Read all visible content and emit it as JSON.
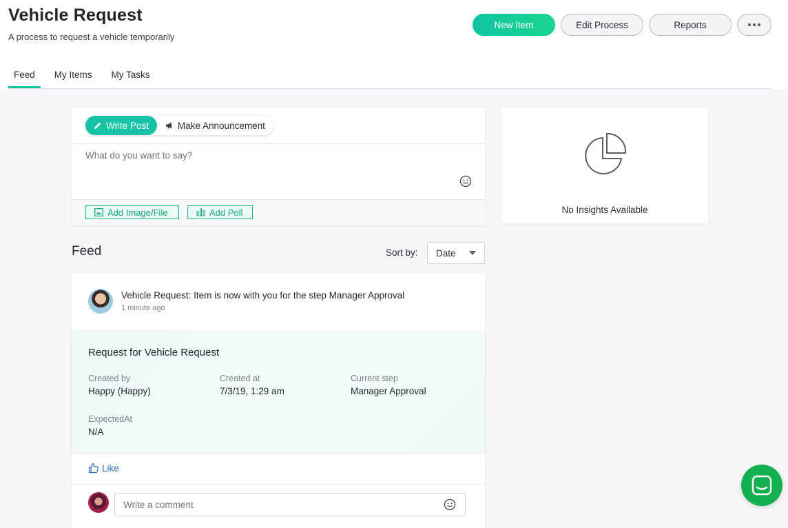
{
  "header": {
    "title": "Vehicle Request",
    "subtitle": "A process to request a vehicle temporarily",
    "buttons": {
      "new_item": "New Item",
      "edit_process": "Edit Process",
      "reports": "Reports"
    },
    "tabs": [
      "Feed",
      "My Items",
      "My Tasks"
    ],
    "active_tab": "Feed"
  },
  "composer": {
    "tabs": {
      "write_post": "Write Post",
      "make_announcement": "Make Announcement"
    },
    "placeholder": "What do you want to say?",
    "add_image": "Add Image/File",
    "add_poll": "Add Poll"
  },
  "insights": {
    "empty_text": "No Insights Available"
  },
  "feed": {
    "title": "Feed",
    "sort_label": "Sort by:",
    "sort_value": "Date",
    "item": {
      "message": "Vehicle Request: Item is now with you for the step Manager Approval",
      "time": "1 minute ago",
      "request_title": "Request for Vehicle Request",
      "fields": {
        "created_by": {
          "label": "Created by",
          "value": "Happy (Happy)"
        },
        "created_at": {
          "label": "Created at",
          "value": "7/3/19, 1:29 am"
        },
        "current_step": {
          "label": "Current step",
          "value": "Manager Approval"
        },
        "expected_at": {
          "label": "ExpectedAt",
          "value": "N/A"
        }
      },
      "like_label": "Like",
      "comment_placeholder": "Write a comment"
    }
  },
  "colors": {
    "accent": "#12c9a2",
    "link": "#2a6fd0",
    "chat": "#12b04e"
  }
}
